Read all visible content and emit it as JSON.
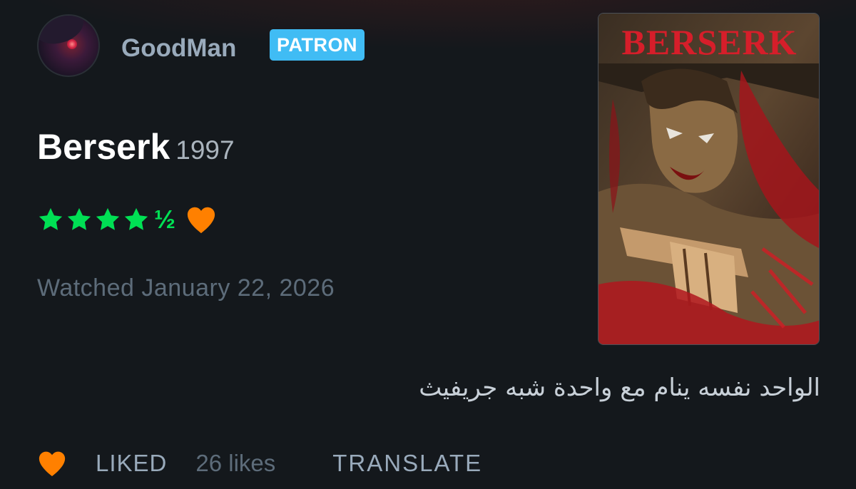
{
  "user": {
    "name": "GoodMan",
    "badge": "PATRON"
  },
  "film": {
    "title": "Berserk",
    "year": "1997",
    "poster_title": "BERSERK"
  },
  "rating": {
    "stars": 4.5,
    "half_glyph": "½",
    "liked": true
  },
  "watched": "Watched January 22, 2026",
  "review": "الواحد نفسه ينام مع واحدة شبه جريفيث",
  "actions": {
    "liked_label": "LIKED",
    "likes_count": "26 likes",
    "translate_label": "TRANSLATE"
  },
  "colors": {
    "background": "#14181c",
    "star_green": "#00e054",
    "heart_orange": "#ff8000",
    "badge_blue": "#40bcf4"
  },
  "icons": {
    "star": "star-icon",
    "heart": "heart-icon"
  }
}
